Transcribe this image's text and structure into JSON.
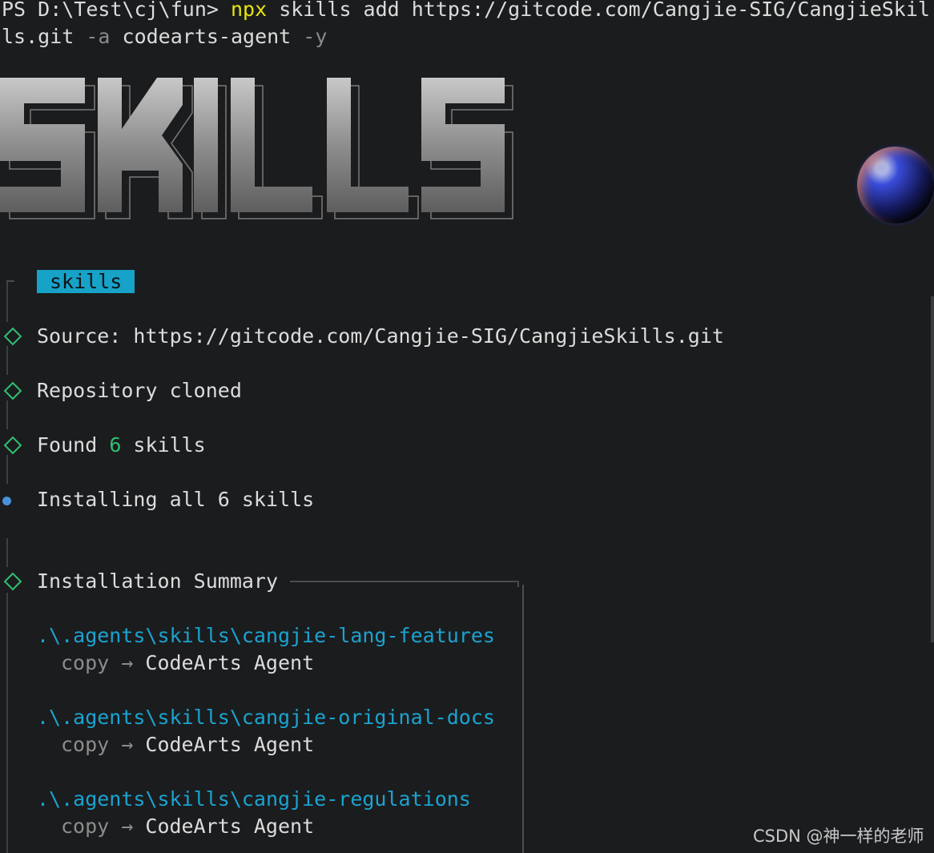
{
  "command": {
    "prompt": "PS D:\\Test\\cj\\fun> ",
    "cmd": "npx",
    "args1": " skills add https://gitcode.com/Cangjie-SIG/CangjieSkil",
    "wrap": "ls.git ",
    "flag_a": "-a",
    "agent": " codearts-agent ",
    "flag_y": "-y"
  },
  "banner": {
    "text": "SKILLS"
  },
  "section_badge": "skills",
  "steps": {
    "source": "Source: https://gitcode.com/Cangjie-SIG/CangjieSkills.git",
    "cloned": "Repository cloned",
    "found_prefix": "Found ",
    "found_count": "6",
    "found_suffix": " skills",
    "installing": "Installing all 6 skills",
    "summary": "Installation Summary"
  },
  "summary_items": [
    {
      "path": ".\\.agents\\skills\\cangjie-lang-features",
      "mode": "copy",
      "arrow": "→",
      "target": "CodeArts Agent"
    },
    {
      "path": ".\\.agents\\skills\\cangjie-original-docs",
      "mode": "copy",
      "arrow": "→",
      "target": "CodeArts Agent"
    },
    {
      "path": ".\\.agents\\skills\\cangjie-regulations",
      "mode": "copy",
      "arrow": "→",
      "target": "CodeArts Agent"
    }
  ],
  "watermark": "CSDN @神一样的老师",
  "colors": {
    "background": "#1b1c1e",
    "accent_cyan": "#1aa3cf",
    "success_green": "#2fbf71",
    "command_yellow": "#e5e510",
    "bullet_blue": "#4a90d9"
  },
  "icons": [
    "diamond-step-icon",
    "bullet-dot-icon",
    "orb-decoration"
  ]
}
